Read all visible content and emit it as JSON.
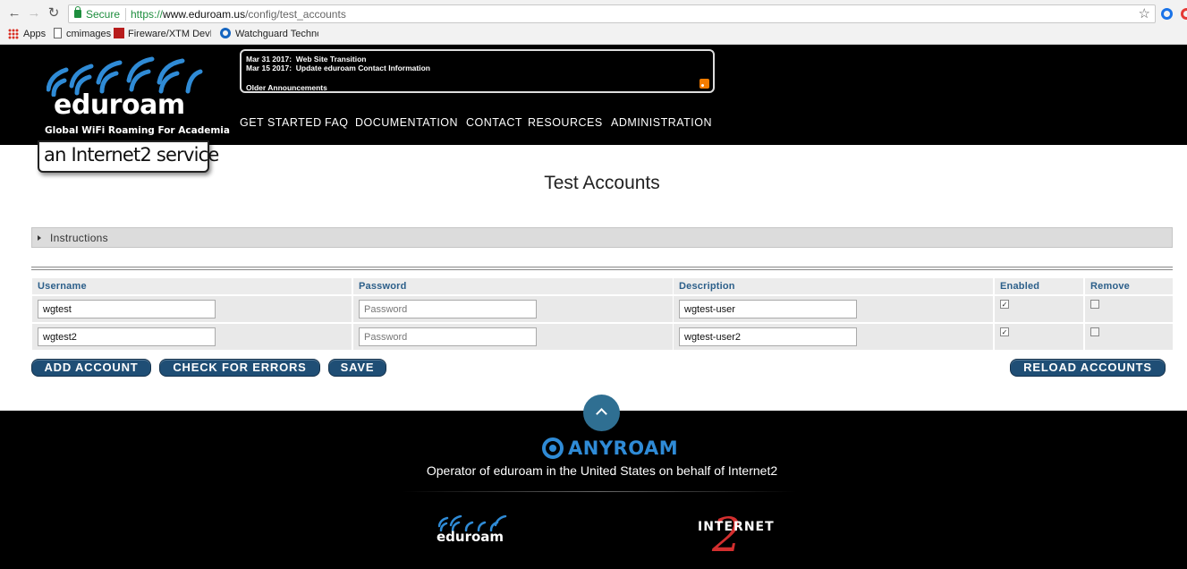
{
  "browser": {
    "secure_label": "Secure",
    "url_scheme": "https://",
    "url_host": "www.eduroam.us",
    "url_path": "/config/test_accounts",
    "bookmarks": [
      "Apps",
      "cmimages",
      "Fireware/XTM DevKey",
      "Watchguard Technolo"
    ]
  },
  "header": {
    "logo_word": "eduroam",
    "logo_tagline": "Global WiFi Roaming For Academia",
    "i2_badge": "an Internet2 service",
    "announcements": [
      {
        "date": "Mar 31 2017:",
        "text": "Web Site Transition"
      },
      {
        "date": "Mar 15 2017:",
        "text": "Update eduroam Contact Information"
      }
    ],
    "older_announcements": "Older Announcements",
    "nav": [
      "GET STARTED",
      "FAQ",
      "DOCUMENTATION",
      "CONTACT",
      "RESOURCES",
      "ADMINISTRATION"
    ]
  },
  "page": {
    "title": "Test Accounts",
    "instructions_label": "Instructions"
  },
  "table": {
    "columns": [
      "Username",
      "Password",
      "Description",
      "Enabled",
      "Remove"
    ],
    "password_placeholder": "Password",
    "rows": [
      {
        "username": "wgtest",
        "password": "",
        "description": "wgtest-user",
        "enabled": true,
        "remove": false
      },
      {
        "username": "wgtest2",
        "password": "",
        "description": "wgtest-user2",
        "enabled": true,
        "remove": false
      }
    ]
  },
  "actions": {
    "add_account": "ADD ACCOUNT",
    "check_errors": "CHECK FOR ERRORS",
    "save": "SAVE",
    "reload": "RELOAD ACCOUNTS"
  },
  "footer": {
    "anyroam": "ANYROAM",
    "operator_text": "Operator of eduroam in the United States on behalf of Internet2",
    "edu_logo_word": "eduroam",
    "i2_logo_word": "INTERNET",
    "i2_logo_two": "2"
  },
  "colors": {
    "brand_blue": "#1f4e75",
    "link_blue": "#2c5f8a",
    "anyroam_blue": "#2f8bd6",
    "secure_green": "#1e8e3e"
  }
}
